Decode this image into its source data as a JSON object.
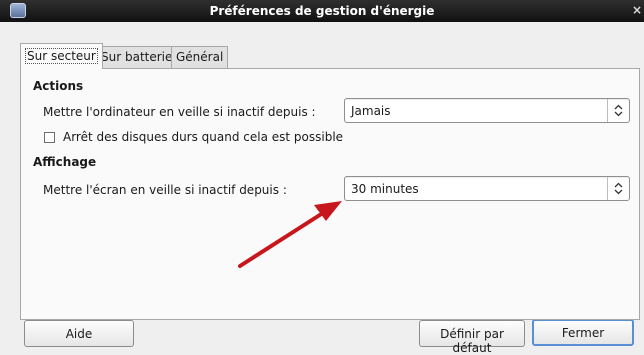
{
  "window": {
    "title": "Préférences de gestion d'énergie",
    "close_glyph": "×"
  },
  "tabs": [
    {
      "label": "Sur secteur",
      "active": true
    },
    {
      "label": "Sur batterie",
      "active": false
    },
    {
      "label": "Général",
      "active": false
    }
  ],
  "actions": {
    "heading": "Actions",
    "sleep_label": "Mettre l'ordinateur en veille si inactif depuis :",
    "sleep_value": "Jamais",
    "disks_checkbox_label": "Arrêt des disques durs quand cela est possible",
    "disks_checked": false
  },
  "display": {
    "heading": "Affichage",
    "screen_sleep_label": "Mettre l'écran en veille si inactif depuis :",
    "screen_sleep_value": "30 minutes"
  },
  "buttons": {
    "help": "Aide",
    "defaults": "Définir par défaut",
    "close": "Fermer"
  },
  "annotation": {
    "color": "#c8161d"
  },
  "icons": [
    "app-icon",
    "combo-arrows-icon",
    "annotation-arrow-icon"
  ]
}
